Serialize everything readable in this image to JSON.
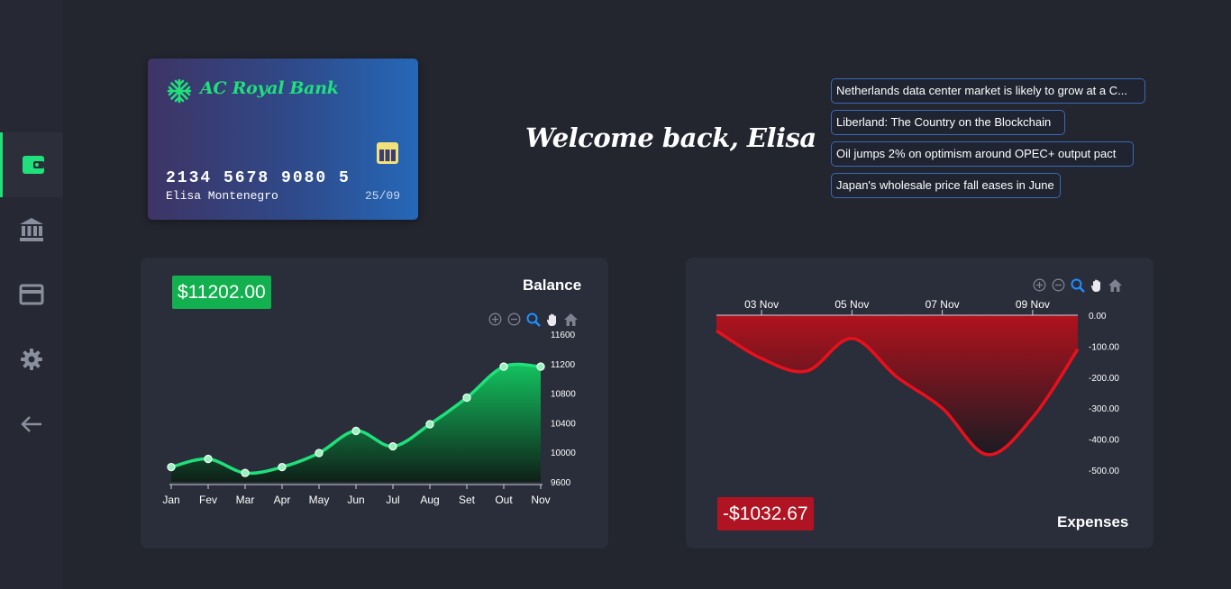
{
  "sidebar": {
    "items": [
      {
        "name": "wallet-icon",
        "active": true
      },
      {
        "name": "bank-icon",
        "active": false
      },
      {
        "name": "credit-card-icon",
        "active": false
      },
      {
        "name": "gear-icon",
        "active": false
      },
      {
        "name": "arrow-left-icon",
        "active": false
      }
    ]
  },
  "card": {
    "bank_name": "AC Royal Bank",
    "logo_icon": "snowflake-icon",
    "chip_icon": "chip-icon",
    "number": "2134 5678 9080 5",
    "holder": "Elisa Montenegro",
    "expiry": "25/09"
  },
  "welcome": "Welcome back, Elisa",
  "news": [
    "Netherlands data center market is likely to grow at a C...",
    "Liberland: The Country on the Blockchain",
    "Oil jumps 2% on optimism around OPEC+ output pact",
    "Japan's wholesale price fall eases in June"
  ],
  "balance": {
    "amount": "$11202.00",
    "title": "Balance"
  },
  "expenses": {
    "amount": "-$1032.67",
    "title": "Expenses"
  },
  "colors": {
    "accent_green": "#1fe07a",
    "accent_red": "#e8101c",
    "background": "#23252f",
    "panel": "#2a2d3a"
  },
  "chart_data": [
    {
      "type": "area",
      "categories": [
        "Jan",
        "Fev",
        "Mar",
        "Apr",
        "May",
        "Jun",
        "Jul",
        "Aug",
        "Set",
        "Out",
        "Nov"
      ],
      "values": [
        9800,
        9910,
        9720,
        9800,
        9990,
        10290,
        10080,
        10380,
        10740,
        11160,
        11160
      ],
      "yticks": [
        "11600",
        "11200",
        "10800",
        "10400",
        "10000",
        "9600"
      ],
      "ylim": [
        9600,
        11600
      ],
      "title": "",
      "xlabel": "",
      "ylabel": ""
    },
    {
      "type": "area",
      "x": [
        "02 Nov",
        "03 Nov",
        "04 Nov",
        "05 Nov",
        "06 Nov",
        "07 Nov",
        "08 Nov",
        "09 Nov",
        "10 Nov"
      ],
      "xticks": [
        "03 Nov",
        "05 Nov",
        "07 Nov",
        "09 Nov"
      ],
      "values": [
        -50,
        -140,
        -180,
        -75,
        -200,
        -300,
        -450,
        -330,
        -110
      ],
      "yticks": [
        "0.00",
        "-100.00",
        "-200.00",
        "-300.00",
        "-400.00",
        "-500.00"
      ],
      "ylim": [
        -500,
        0
      ],
      "title": "",
      "xlabel": "",
      "ylabel": ""
    }
  ]
}
